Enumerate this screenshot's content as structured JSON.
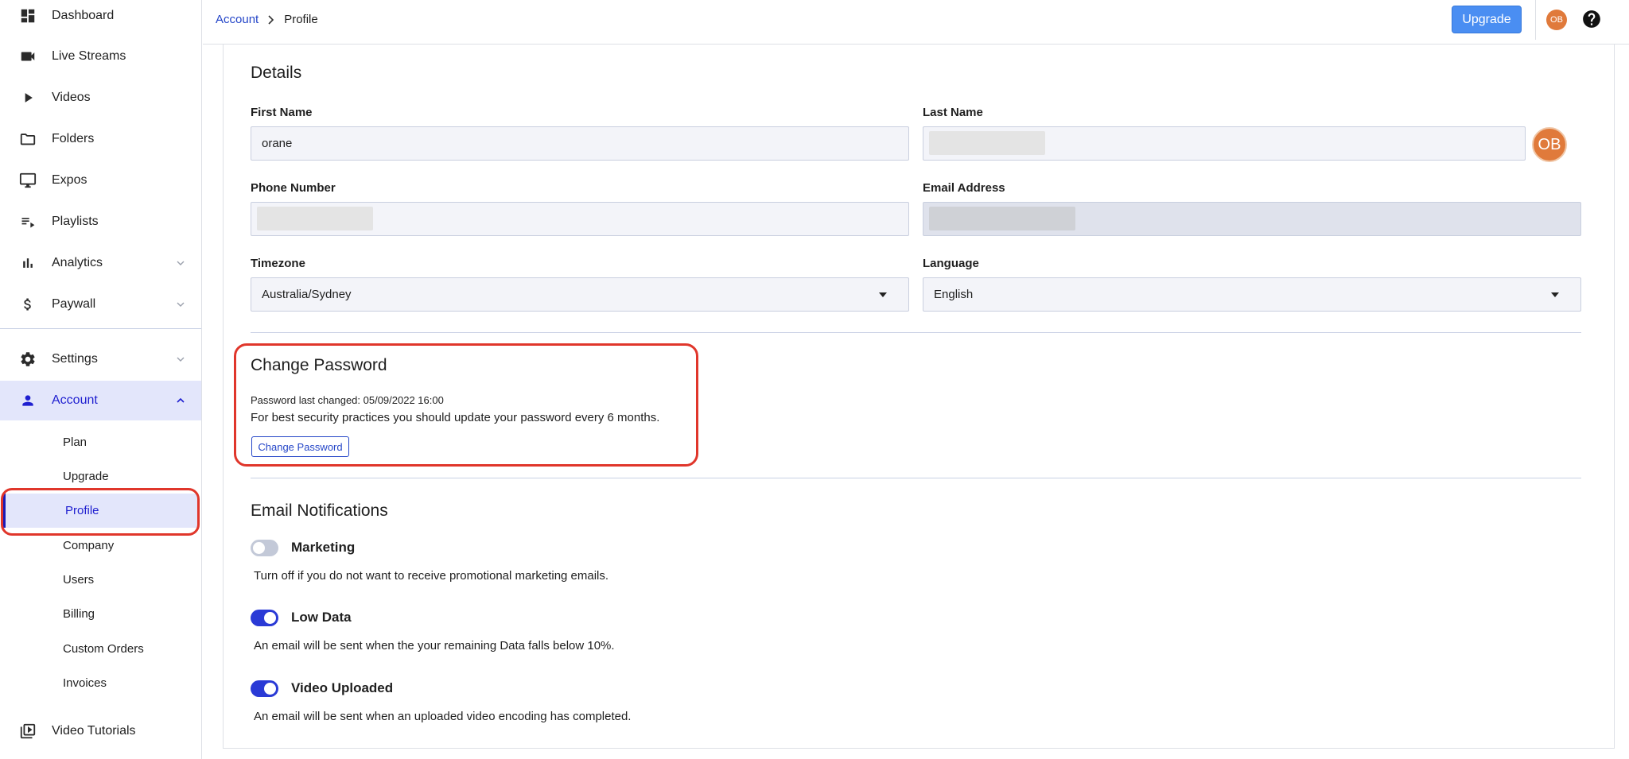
{
  "sidebar": {
    "items": [
      {
        "label": "Dashboard",
        "icon": "dashboard-icon"
      },
      {
        "label": "Live Streams",
        "icon": "video-camera-icon"
      },
      {
        "label": "Videos",
        "icon": "play-icon"
      },
      {
        "label": "Folders",
        "icon": "folder-icon"
      },
      {
        "label": "Expos",
        "icon": "monitor-icon"
      },
      {
        "label": "Playlists",
        "icon": "playlist-icon"
      },
      {
        "label": "Analytics",
        "icon": "bar-chart-icon"
      },
      {
        "label": "Paywall",
        "icon": "dollar-icon"
      },
      {
        "label": "Settings",
        "icon": "gear-icon"
      },
      {
        "label": "Account",
        "icon": "person-icon"
      }
    ],
    "account_subitems": [
      "Plan",
      "Upgrade",
      "Profile",
      "Company",
      "Users",
      "Billing",
      "Custom Orders",
      "Invoices"
    ],
    "bottom_item": {
      "label": "Video Tutorials",
      "icon": "video-library-icon"
    }
  },
  "topbar": {
    "breadcrumb": {
      "parent": "Account",
      "current": "Profile"
    },
    "upgrade_label": "Upgrade",
    "avatar_initials": "OB",
    "help_icon": "help-circle-icon"
  },
  "details": {
    "heading": "Details",
    "first_name": {
      "label": "First Name",
      "value": "orane"
    },
    "last_name": {
      "label": "Last Name",
      "value": ""
    },
    "phone": {
      "label": "Phone Number",
      "value": ""
    },
    "email": {
      "label": "Email Address",
      "value": ""
    },
    "timezone": {
      "label": "Timezone",
      "value": "Australia/Sydney"
    },
    "language": {
      "label": "Language",
      "value": "English"
    },
    "avatar_initials": "OB"
  },
  "password": {
    "heading": "Change Password",
    "last_changed": "Password last changed: 05/09/2022 16:00",
    "advice": "For best security practices you should update your password every 6 months.",
    "button_label": "Change Password"
  },
  "notifications": {
    "heading": "Email Notifications",
    "items": [
      {
        "title": "Marketing",
        "desc": "Turn off if you do not want to receive promotional marketing emails.",
        "enabled": false
      },
      {
        "title": "Low Data",
        "desc": "An email will be sent when the your remaining Data falls below 10%.",
        "enabled": true
      },
      {
        "title": "Video Uploaded",
        "desc": "An email will be sent when an uploaded video encoding has completed.",
        "enabled": true
      }
    ]
  },
  "colors": {
    "accent": "#2546c8",
    "active_bg": "#e3e6fb",
    "toggle_on": "#2a3ad6",
    "avatar": "#e07a3b",
    "highlight_box": "#e0362b",
    "upgrade_button": "#4a8ef2"
  }
}
